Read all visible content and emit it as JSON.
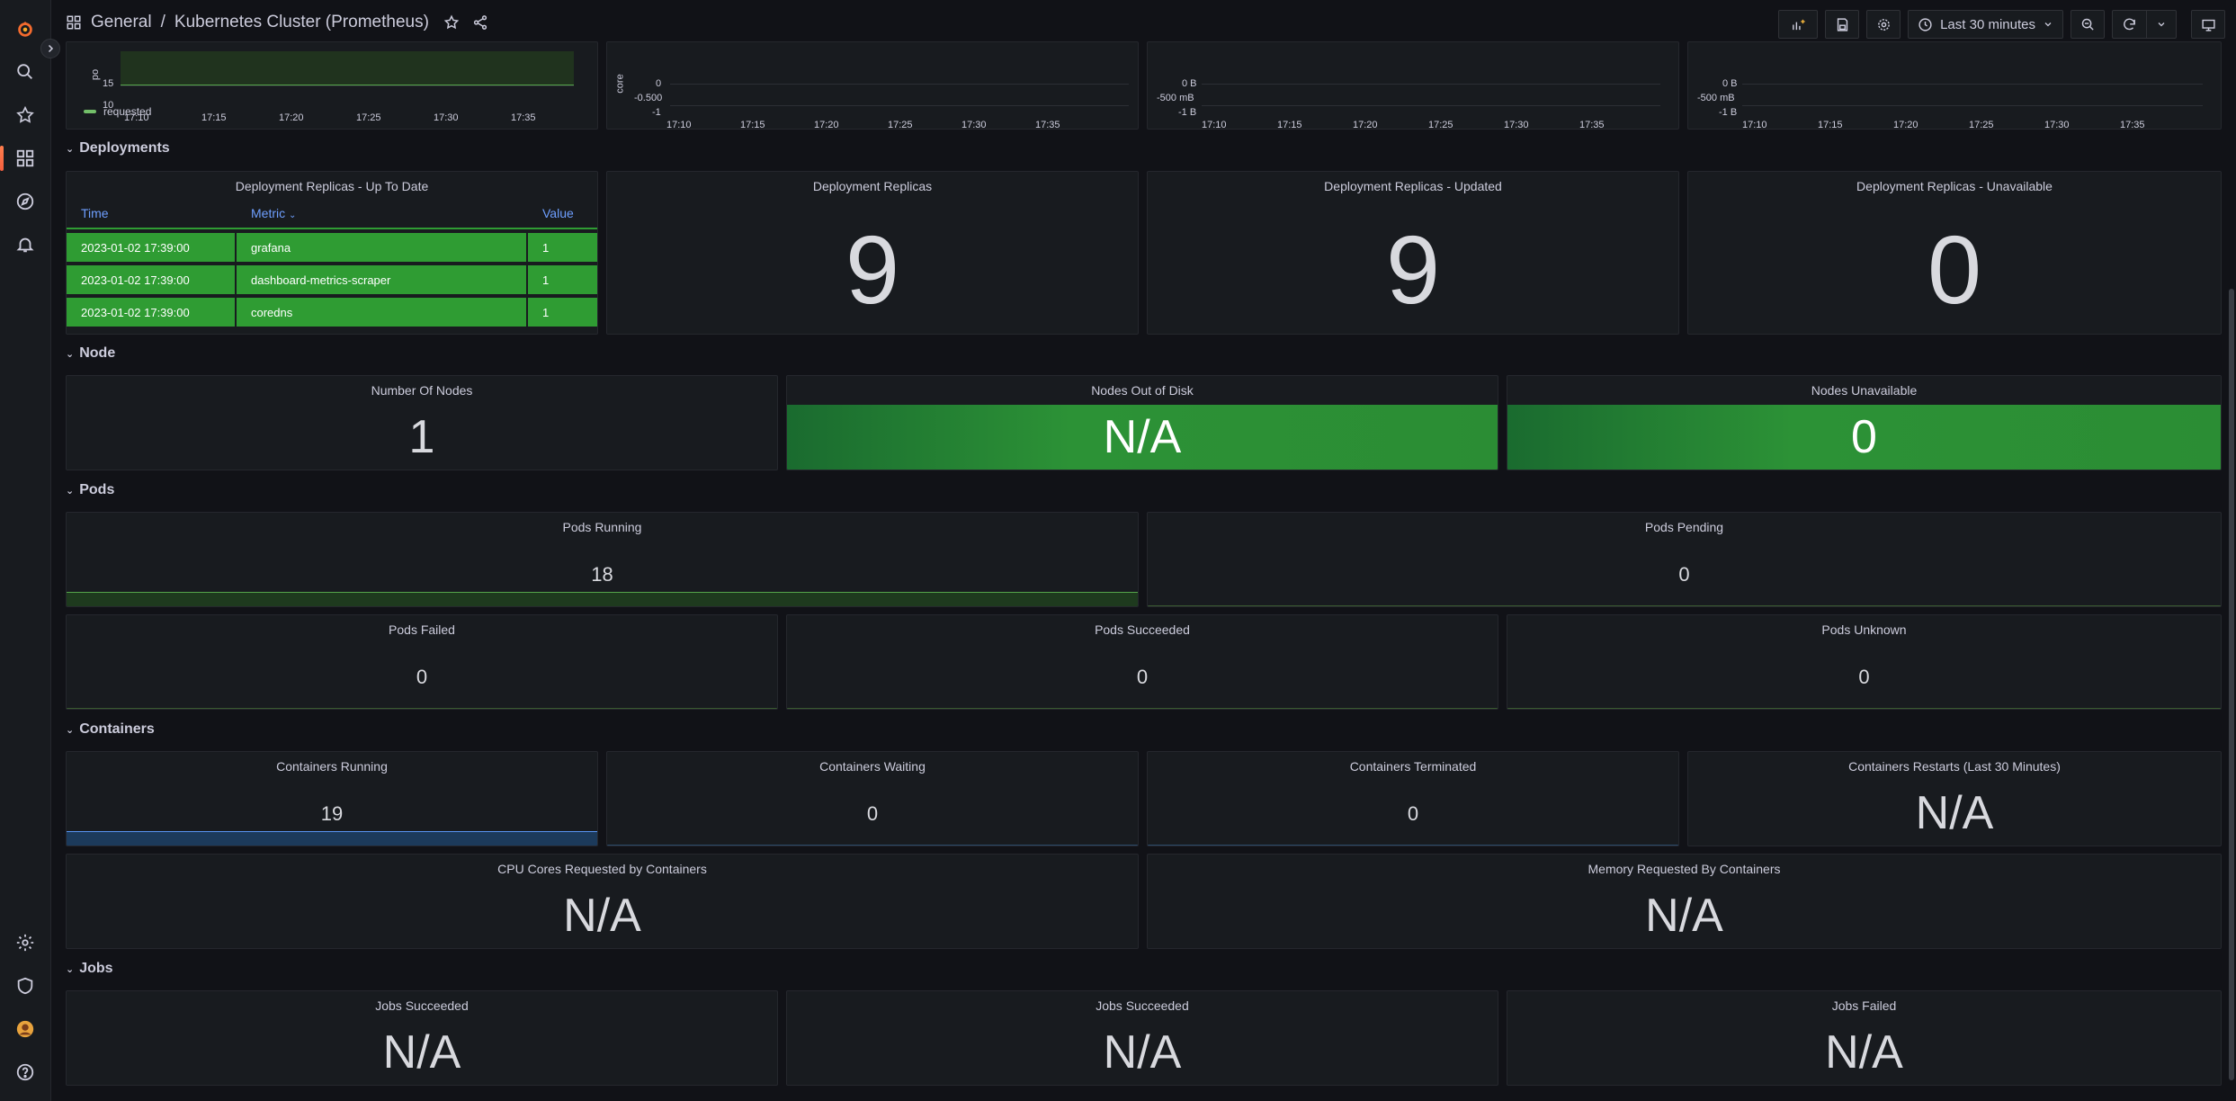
{
  "breadcrumb": {
    "folder": "General",
    "separator": "/",
    "title": "Kubernetes Cluster (Prometheus)"
  },
  "toolbar": {
    "time_range": "Last 30 minutes"
  },
  "top_charts": {
    "left": {
      "y_ticks": [
        "15",
        "10"
      ],
      "y_label": "po",
      "x_ticks": [
        "17:10",
        "17:15",
        "17:20",
        "17:25",
        "17:30",
        "17:35"
      ],
      "legend": "requested"
    },
    "cpu": {
      "y_ticks": [
        "0",
        "-0.500",
        "-1"
      ],
      "y_label": "core",
      "x_ticks": [
        "17:10",
        "17:15",
        "17:20",
        "17:25",
        "17:30",
        "17:35"
      ]
    },
    "mem1": {
      "y_ticks": [
        "0 B",
        "-500 mB",
        "-1 B"
      ],
      "x_ticks": [
        "17:10",
        "17:15",
        "17:20",
        "17:25",
        "17:30",
        "17:35"
      ]
    },
    "mem2": {
      "y_ticks": [
        "0 B",
        "-500 mB",
        "-1 B"
      ],
      "x_ticks": [
        "17:10",
        "17:15",
        "17:20",
        "17:25",
        "17:30",
        "17:35"
      ]
    }
  },
  "rows": {
    "deployments": "Deployments",
    "node": "Node",
    "pods": "Pods",
    "containers": "Containers",
    "jobs": "Jobs"
  },
  "deployments": {
    "table": {
      "title": "Deployment Replicas - Up To Date",
      "columns": [
        "Time",
        "Metric",
        "Value"
      ],
      "rows": [
        [
          "2023-01-02 17:39:00",
          "grafana",
          "1"
        ],
        [
          "2023-01-02 17:39:00",
          "dashboard-metrics-scraper",
          "1"
        ],
        [
          "2023-01-02 17:39:00",
          "coredns",
          "1"
        ]
      ]
    },
    "replicas": {
      "title": "Deployment Replicas",
      "value": "9"
    },
    "updated": {
      "title": "Deployment Replicas - Updated",
      "value": "9"
    },
    "unavailable": {
      "title": "Deployment Replicas - Unavailable",
      "value": "0"
    }
  },
  "node": {
    "count": {
      "title": "Number Of Nodes",
      "value": "1"
    },
    "out_of_disk": {
      "title": "Nodes Out of Disk",
      "value": "N/A"
    },
    "unavailable": {
      "title": "Nodes Unavailable",
      "value": "0"
    }
  },
  "pods": {
    "running": {
      "title": "Pods Running",
      "value": "18"
    },
    "pending": {
      "title": "Pods Pending",
      "value": "0"
    },
    "failed": {
      "title": "Pods Failed",
      "value": "0"
    },
    "succeeded": {
      "title": "Pods Succeeded",
      "value": "0"
    },
    "unknown": {
      "title": "Pods Unknown",
      "value": "0"
    }
  },
  "containers": {
    "running": {
      "title": "Containers Running",
      "value": "19"
    },
    "waiting": {
      "title": "Containers Waiting",
      "value": "0"
    },
    "terminated": {
      "title": "Containers Terminated",
      "value": "0"
    },
    "restarts": {
      "title": "Containers Restarts (Last 30 Minutes)",
      "value": "N/A"
    },
    "cpu_requested": {
      "title": "CPU Cores Requested by Containers",
      "value": "N/A"
    },
    "memory_requested": {
      "title": "Memory Requested By Containers",
      "value": "N/A"
    }
  },
  "jobs": {
    "succeeded_1": {
      "title": "Jobs Succeeded",
      "value": "N/A"
    },
    "succeeded_2": {
      "title": "Jobs Succeeded",
      "value": "N/A"
    },
    "failed": {
      "title": "Jobs Failed",
      "value": "N/A"
    }
  },
  "colors": {
    "accent": "#f55f3e",
    "green": "#2f9c33",
    "link": "#6e9fff",
    "panel": "#181b1f",
    "bg": "#111217"
  }
}
